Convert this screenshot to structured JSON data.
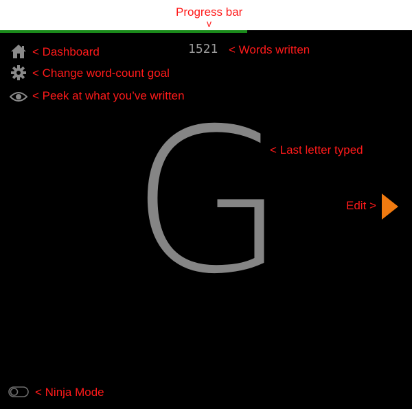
{
  "app": {
    "word_count": "1521",
    "last_letter": "G"
  },
  "progress": {
    "fraction": 0.6
  },
  "icons": {
    "dashboard": "home-icon",
    "settings": "gear-icon",
    "peek": "eye-icon",
    "edit": "triangle-right-icon",
    "ninja": "toggle-icon"
  },
  "annotations": {
    "progress_bar": "Progress bar",
    "progress_caret": "v",
    "dashboard": "< Dashboard",
    "goal": "< Change word-count goal",
    "peek": "< Peek at what you’ve written",
    "words": "< Words written",
    "last_letter": "< Last letter typed",
    "edit": "Edit >",
    "ninja": "< Ninja Mode"
  },
  "colors": {
    "background": "#000000",
    "progress": "#1a8a1a",
    "annotation": "#ff1a1a",
    "icon": "#8a8a8a",
    "letter": "#858585",
    "edit_arrow": "#f07a10"
  }
}
